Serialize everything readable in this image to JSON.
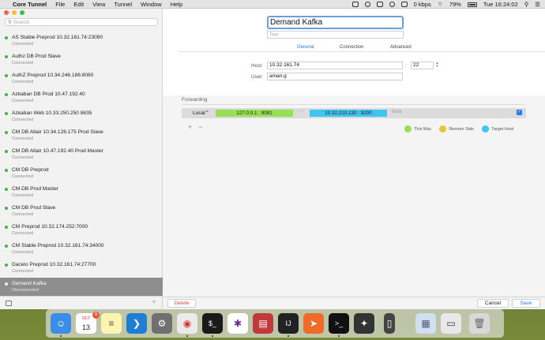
{
  "menubar": {
    "apple": "",
    "app_name": "Core Tunnel",
    "menus": [
      "File",
      "Edit",
      "View",
      "Tunnel",
      "Window",
      "Help"
    ],
    "network_speed": "0 kbps",
    "battery": "79%",
    "clock": "Tue 16:24:02"
  },
  "sidebar": {
    "search_placeholder": "Search",
    "items": [
      {
        "name": "AS Stable Preprod 10.32.161.74:23090",
        "status": "Connected"
      },
      {
        "name": "Authz DB Prod Slave",
        "status": "Connected"
      },
      {
        "name": "AuthZ Preprod 10.34.246.186:8080",
        "status": "Connected"
      },
      {
        "name": "Azkaban DB Prod 10.47.192.40",
        "status": "Connected"
      },
      {
        "name": "Azkaban Web 10.33.250.250 8635",
        "status": "Connected"
      },
      {
        "name": "CM DB Altair 10.34.126.175 Prod Slave",
        "status": "Connected"
      },
      {
        "name": "CM DB Altair 10.47.192.40 Prod Master",
        "status": "Connected"
      },
      {
        "name": "CM DB Preprod",
        "status": "Connected"
      },
      {
        "name": "CM DB Prod Master",
        "status": "Connected"
      },
      {
        "name": "CM DB Prod Slave",
        "status": "Connected"
      },
      {
        "name": "CM Preprod 10.32.174.252:7000",
        "status": "Connected"
      },
      {
        "name": "CM Stable Preprod 10.32.161.74:34000",
        "status": "Connected"
      },
      {
        "name": "Dacelo Preprod 10.32.161.74:27700",
        "status": "Connected"
      },
      {
        "name": "Demand Kafka",
        "status": "Disconnected"
      }
    ],
    "add_symbol": "+"
  },
  "editor": {
    "title_value": "Demand Kafka",
    "tags_placeholder": "Tags",
    "tabs": [
      "General",
      "Connection",
      "Advanced"
    ],
    "host_label": "Host",
    "host_value": "10.32.161.74",
    "port_sep": ":",
    "port_value": "22",
    "user_label": "User",
    "user_value": "aman.g"
  },
  "forwarding": {
    "section_label": "Forwarding",
    "mode": "Local",
    "source": "127.0.0.1  :  9081",
    "arrow": "—›",
    "target": "10.32.210.130  :  9200",
    "note_placeholder": "Note",
    "check": "✓",
    "add": "+",
    "remove": "−",
    "legend": [
      {
        "label": "This Mac",
        "color": "#97e055"
      },
      {
        "label": "Remote Side",
        "color": "#e6c540"
      },
      {
        "label": "Target Host",
        "color": "#3ec5f0"
      }
    ]
  },
  "footer": {
    "delete": "Delete",
    "cancel": "Cancel",
    "save": "Save"
  },
  "dock": {
    "calendar_month": "OCT",
    "calendar_day": "13",
    "badge": "9"
  }
}
